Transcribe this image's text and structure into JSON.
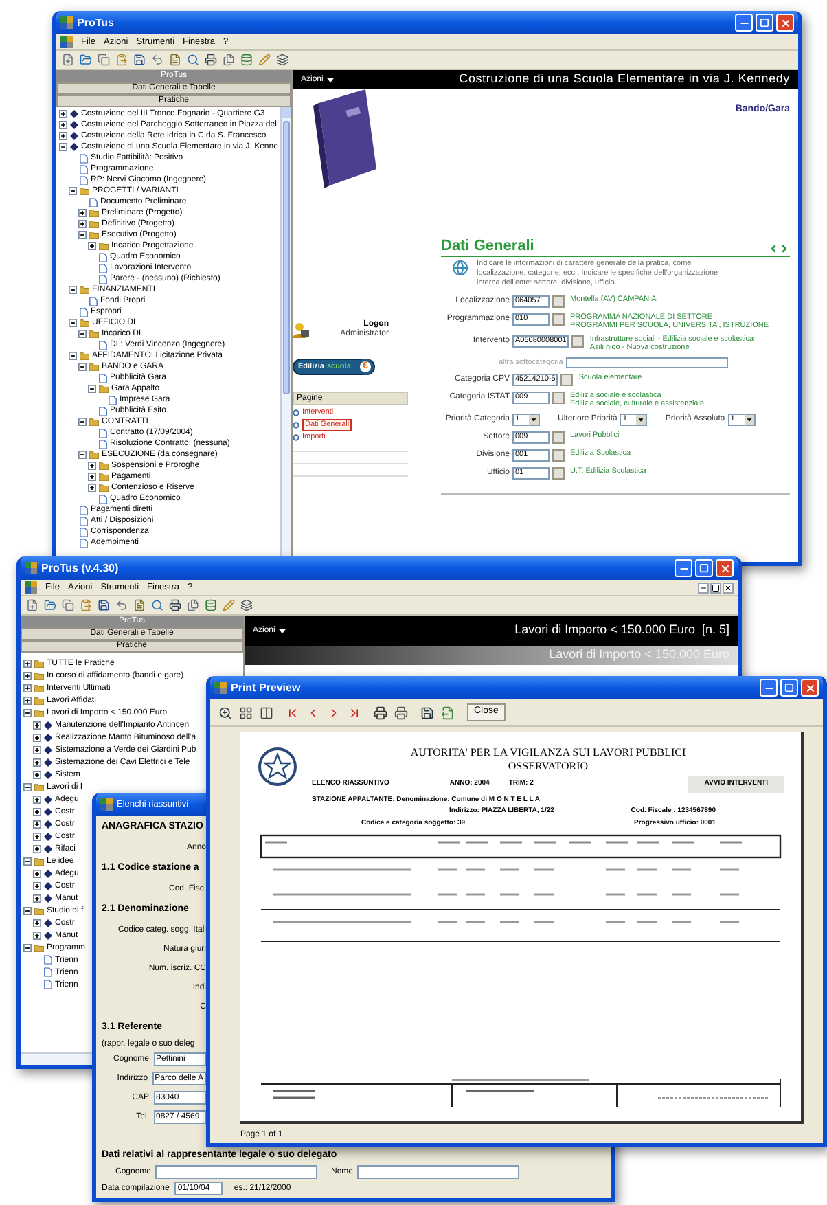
{
  "main_window": {
    "title": "ProTus",
    "menu": [
      "File",
      "Azioni",
      "Strumenti",
      "Finestra",
      "?"
    ],
    "sidebar": {
      "header": "ProTus",
      "sections": [
        "Dati Generali e Tabelle",
        "Pratiche"
      ],
      "tree": [
        {
          "label": "Costruzione del III Tronco Fognario - Quartiere G3",
          "kind": "project",
          "expanded": false
        },
        {
          "label": "Costruzione del Parcheggio Sotterraneo in Piazza del",
          "kind": "project",
          "expanded": false
        },
        {
          "label": "Costruzione della Rete Idrica in C.da S. Francesco",
          "kind": "project",
          "expanded": false
        },
        {
          "label": "Costruzione di una Scuola Elementare in via J. Kenne",
          "kind": "project",
          "expanded": true,
          "children": [
            {
              "label": "Studio Fattibilità: Positivo",
              "kind": "doc"
            },
            {
              "label": "Programmazione",
              "kind": "doc"
            },
            {
              "label": "RP: Nervi Giacomo (Ingegnere)",
              "kind": "doc"
            },
            {
              "label": "PROGETTI / VARIANTI",
              "kind": "folder",
              "expanded": true,
              "children": [
                {
                  "label": "Documento Preliminare",
                  "kind": "doc"
                },
                {
                  "label": "Preliminare (Progetto)",
                  "kind": "folder",
                  "expanded": false
                },
                {
                  "label": "Definitivo (Progetto)",
                  "kind": "folder",
                  "expanded": false
                },
                {
                  "label": "Esecutivo (Progetto)",
                  "kind": "folder",
                  "expanded": true,
                  "children": [
                    {
                      "label": "Incarico Progettazione",
                      "kind": "folder",
                      "expanded": false
                    },
                    {
                      "label": "Quadro Economico",
                      "kind": "doc"
                    },
                    {
                      "label": "Lavorazioni Intervento",
                      "kind": "doc"
                    },
                    {
                      "label": "Parere - (nessuno) (Richiesto)",
                      "kind": "doc"
                    }
                  ]
                }
              ]
            },
            {
              "label": "FINANZIAMENTI",
              "kind": "folder",
              "expanded": true,
              "children": [
                {
                  "label": "Fondi Propri",
                  "kind": "doc"
                }
              ]
            },
            {
              "label": "Espropri",
              "kind": "doc"
            },
            {
              "label": "UFFICIO DL",
              "kind": "folder",
              "expanded": true,
              "children": [
                {
                  "label": "Incarico DL",
                  "kind": "folder",
                  "expanded": true,
                  "children": [
                    {
                      "label": "DL: Verdi Vincenzo (Ingegnere)",
                      "kind": "doc"
                    }
                  ]
                }
              ]
            },
            {
              "label": "AFFIDAMENTO: Licitazione Privata",
              "kind": "folder",
              "expanded": true,
              "children": [
                {
                  "label": "BANDO e GARA",
                  "kind": "folder",
                  "expanded": true,
                  "children": [
                    {
                      "label": "Pubblicità Gara",
                      "kind": "doc"
                    },
                    {
                      "label": "Gara Appalto",
                      "kind": "folder",
                      "expanded": true,
                      "children": [
                        {
                          "label": "Imprese Gara",
                          "kind": "doc"
                        }
                      ]
                    },
                    {
                      "label": "Pubblicità Esito",
                      "kind": "doc"
                    }
                  ]
                },
                {
                  "label": "CONTRATTI",
                  "kind": "folder",
                  "expanded": true,
                  "children": [
                    {
                      "label": "Contratto (17/09/2004)",
                      "kind": "doc"
                    },
                    {
                      "label": "Risoluzione Contratto: (nessuna)",
                      "kind": "doc"
                    }
                  ]
                },
                {
                  "label": "ESECUZIONE (da consegnare)",
                  "kind": "folder",
                  "expanded": true,
                  "children": [
                    {
                      "label": "Sospensioni e Proroghe",
                      "kind": "folder",
                      "expanded": false
                    },
                    {
                      "label": "Pagamenti",
                      "kind": "folder",
                      "expanded": false
                    },
                    {
                      "label": "Contenzioso e Riserve",
                      "kind": "folder",
                      "expanded": false
                    },
                    {
                      "label": "Quadro Economico",
                      "kind": "doc"
                    }
                  ]
                }
              ]
            },
            {
              "label": "Pagamenti diretti",
              "kind": "doc"
            },
            {
              "label": "Atti / Disposizioni",
              "kind": "doc"
            },
            {
              "label": "Corrispondenza",
              "kind": "doc"
            },
            {
              "label": "Adempimenti",
              "kind": "doc"
            }
          ]
        }
      ]
    },
    "content": {
      "actions": "Azioni",
      "title": "Costruzione di una Scuola Elementare in via J. Kennedy",
      "breadcrumb": "Bando/Gara",
      "user": {
        "role": "Logon",
        "name": "Administrator"
      },
      "badge": {
        "first": "Edilizia",
        "second": "scuola",
        "symbol": "€"
      },
      "pages": {
        "title": "Pagine",
        "items": [
          {
            "label": "Interventi",
            "selected": false
          },
          {
            "label": "Dati Generali",
            "selected": true
          },
          {
            "label": "Importi",
            "selected": false
          }
        ]
      },
      "section": {
        "title": "Dati Generali",
        "description": "Indicare le informazioni di carattere generale della pratica, come localizzazione, categorie, ecc.. Indicare le specifiche dell'organizzazione interna dell'ente: settore, divisione, ufficio.",
        "fields": [
          {
            "kind": "lookup",
            "label": "Localizzazione",
            "value": "064057",
            "description": [
              "Montella (AV) CAMPANIA"
            ]
          },
          {
            "kind": "lookup",
            "label": "Programmazione",
            "value": "010",
            "description": [
              "PROGRAMMA NAZIONALE DI SETTORE",
              "PROGRAMMI PER SCUOLA, UNIVERSITA', ISTRUZIONE"
            ]
          },
          {
            "kind": "lookup",
            "label": "Intervento",
            "value": "A05080008001",
            "description": [
              "Infrastrutture sociali - Edilizia sociale e scolastica",
              "Asili nido - Nuova costruzione"
            ]
          },
          {
            "kind": "input",
            "label": "altra sottocategoria"
          },
          {
            "kind": "lookup",
            "label": "Categoria CPV",
            "value": "45214210-5",
            "description": [
              "Scuola elementare"
            ]
          },
          {
            "kind": "lookup",
            "label": "Categoria ISTAT",
            "value": "009",
            "description": [
              "Edilizia sociale e scolastica",
              "Edilizia sociale, culturale e assistenziale"
            ]
          },
          {
            "kind": "selects",
            "items": [
              {
                "label": "Priorità Categoria",
                "value": "1"
              },
              {
                "label": "Ulteriore Priorità",
                "value": "1"
              },
              {
                "label": "Priorità Assoluta",
                "value": "1"
              }
            ]
          },
          {
            "kind": "lookup",
            "label": "Settore",
            "value": "009",
            "description": [
              "Lavori Pubblici"
            ]
          },
          {
            "kind": "lookup",
            "label": "Divisione",
            "value": "001",
            "description": [
              "Edilizia Scolastica"
            ]
          },
          {
            "kind": "lookup",
            "label": "Ufficio",
            "value": "01",
            "description": [
              "U.T. Edilizia Scolastica"
            ]
          }
        ]
      }
    }
  },
  "list_window": {
    "title": "ProTus (v.4.30)",
    "menu": [
      "File",
      "Azioni",
      "Strumenti",
      "Finestra",
      "?"
    ],
    "sidebar": {
      "header": "ProTus",
      "sections": [
        "Dati Generali e Tabelle",
        "Pratiche"
      ],
      "tree": [
        {
          "label": "TUTTE le Pratiche",
          "kind": "folder",
          "expanded": false
        },
        {
          "label": "In corso di affidamento (bandi e gare)",
          "kind": "folder",
          "expanded": false
        },
        {
          "label": "Interventi Ultimati",
          "kind": "folder",
          "expanded": false
        },
        {
          "label": "Lavori Affidati",
          "kind": "folder",
          "expanded": false
        },
        {
          "label": "Lavori di Importo < 150.000 Euro",
          "kind": "folder",
          "expanded": true,
          "children": [
            {
              "label": "Manutenzione dell'Impianto Antincen",
              "kind": "project",
              "expanded": false
            },
            {
              "label": "Realizzazione Manto Bituminoso dell'a",
              "kind": "project",
              "expanded": false
            },
            {
              "label": "Sistemazione a Verde dei Giardini Pub",
              "kind": "project",
              "expanded": false
            },
            {
              "label": "Sistemazione dei Cavi Elettrici e Tele",
              "kind": "project",
              "expanded": false
            },
            {
              "label": "Sistem",
              "kind": "project",
              "expanded": false
            }
          ]
        },
        {
          "label": "Lavori di I",
          "kind": "folder",
          "expanded": true,
          "children": [
            {
              "label": "Adegu",
              "kind": "project",
              "expanded": false
            },
            {
              "label": "Costr",
              "kind": "project",
              "expanded": false
            },
            {
              "label": "Costr",
              "kind": "project",
              "expanded": false
            },
            {
              "label": "Costr",
              "kind": "project",
              "expanded": false
            },
            {
              "label": "Rifaci",
              "kind": "project",
              "expanded": false
            }
          ]
        },
        {
          "label": "Le idee",
          "kind": "folder",
          "expanded": true,
          "children": [
            {
              "label": "Adegu",
              "kind": "project",
              "expanded": false
            },
            {
              "label": "Costr",
              "kind": "project",
              "expanded": false
            },
            {
              "label": "Manut",
              "kind": "project",
              "expanded": false
            }
          ]
        },
        {
          "label": "Studio di f",
          "kind": "folder",
          "expanded": true,
          "children": [
            {
              "label": "Costr",
              "kind": "project",
              "expanded": false
            },
            {
              "label": "Manut",
              "kind": "project",
              "expanded": false
            }
          ]
        },
        {
          "label": "Programm",
          "kind": "folder",
          "expanded": true,
          "children": [
            {
              "label": "Trienn",
              "kind": "doc"
            },
            {
              "label": "Trienn",
              "kind": "doc"
            },
            {
              "label": "Trienn",
              "kind": "doc"
            }
          ]
        }
      ]
    },
    "content": {
      "actions": "Azioni",
      "title": "Lavori di Importo < 150.000 Euro  [n. 5]",
      "subtitle": "Lavori di Importo < 150.000 Euro"
    }
  },
  "dialog": {
    "title": "Elenchi riassuntivi",
    "rows": [
      {
        "kind": "heading",
        "text": "ANAGRAFICA STAZIO"
      },
      {
        "kind": "label",
        "text": "Anno"
      },
      {
        "kind": "heading",
        "text": "1.1 Codice stazione a"
      },
      {
        "kind": "label",
        "text": "Cod. Fisc."
      },
      {
        "kind": "heading",
        "text": "2.1 Denominazione"
      },
      {
        "kind": "label",
        "text": "Codice categ. sogg. Itali"
      },
      {
        "kind": "label",
        "text": "Natura giuri"
      },
      {
        "kind": "label",
        "text": "Num. iscriz. CC"
      },
      {
        "kind": "label",
        "text": "Indi"
      },
      {
        "kind": "label",
        "text": "C"
      },
      {
        "kind": "heading",
        "text": "3.1 Referente"
      },
      {
        "kind": "note",
        "text": "(rappr. legale o suo deleg"
      },
      {
        "kind": "input",
        "label": "Cognome",
        "value": "Pettinini"
      },
      {
        "kind": "input",
        "label": "Indirizzo",
        "value": "Parco delle A"
      },
      {
        "kind": "input",
        "label": "CAP",
        "value": "83040"
      },
      {
        "kind": "input",
        "label": "Tel.",
        "value": "0827 / 4569"
      }
    ],
    "footer": {
      "heading": "Dati relativi al rappresentante legale o suo delegato",
      "fields": [
        {
          "label": "Cognome"
        },
        {
          "label": "Nome"
        }
      ],
      "date": {
        "label": "Data compilazione",
        "value": "01/10/04",
        "hint": "es.: 21/12/2000"
      }
    }
  },
  "print_preview": {
    "title": "Print Preview",
    "close": "Close",
    "status": "Page 1 of 1",
    "report": {
      "heading": [
        "AUTORITA' PER LA VIGILANZA SUI LAVORI PUBBLICI",
        "OSSERVATORIO"
      ],
      "list_title": "ELENCO RIASSUNTIVO",
      "year": "ANNO: 2004",
      "quarter": "TRIM: 2",
      "section": "AVVIO INTERVENTI",
      "station": "STAZIONE APPALTANTE: Denominazione: Comune di M O N T E L L A",
      "address": "Indirizzo: PIAZZA LIBERTA, 1/22",
      "tax_code": "Cod. Fiscale : 1234567890",
      "category": "Codice e categoria soggetto: 39",
      "office": "Progressivo ufficio: 0001"
    }
  }
}
